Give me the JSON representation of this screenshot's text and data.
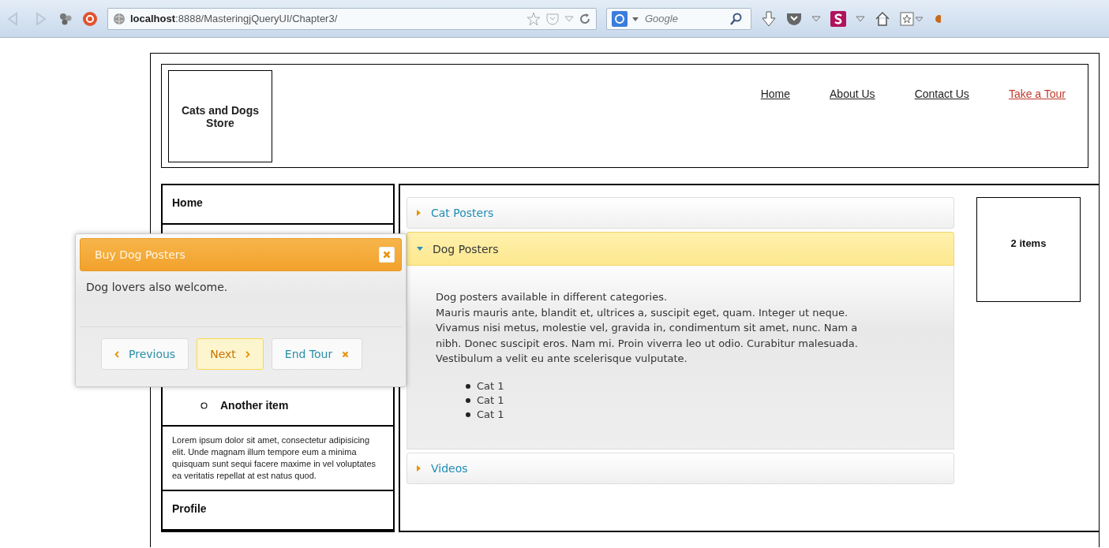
{
  "browser": {
    "url_host": "localhost",
    "url_path": ":8888/MasteringjQueryUI/Chapter3/",
    "search_placeholder": "Google"
  },
  "header": {
    "logo": "Cats and Dogs Store",
    "nav": [
      {
        "label": "Home",
        "highlighted": false
      },
      {
        "label": "About Us",
        "highlighted": false
      },
      {
        "label": "Contact Us",
        "highlighted": false
      },
      {
        "label": "Take a Tour",
        "highlighted": true
      }
    ]
  },
  "sidebar": {
    "items": [
      {
        "kind": "link",
        "label": "Home"
      },
      {
        "kind": "subitem",
        "label": "Another item"
      },
      {
        "kind": "text",
        "label": "Lorem ipsum dolor sit amet, consectetur adipisicing elit. Unde magnam illum tempore eum a minima quisquam sunt sequi facere maxime in vel voluptates ea veritatis repellat at est natus quod."
      },
      {
        "kind": "link",
        "label": "Profile"
      }
    ]
  },
  "accordion": {
    "sections": [
      {
        "title": "Cat Posters",
        "expanded": false
      },
      {
        "title": "Dog Posters",
        "expanded": true,
        "paragraphs": [
          "Dog posters available in different categories.",
          "Mauris mauris ante, blandit et, ultrices a, suscipit eget, quam. Integer ut neque. Vivamus nisi metus, molestie vel, gravida in, condimentum sit amet, nunc. Nam a nibh. Donec suscipit eros. Nam mi. Proin viverra leo ut odio. Curabitur malesuada. Vestibulum a velit eu ante scelerisque vulputate."
        ],
        "list": [
          "Cat 1",
          "Cat 1",
          "Cat 1"
        ]
      },
      {
        "title": "Videos",
        "expanded": false
      }
    ]
  },
  "cart": {
    "label": "2 items"
  },
  "tour": {
    "title": "Buy Dog Posters",
    "body": "Dog lovers also welcome.",
    "buttons": [
      {
        "label": "Previous",
        "kind": "previous",
        "focused": false
      },
      {
        "label": "Next",
        "kind": "next",
        "focused": true
      },
      {
        "label": "End Tour",
        "kind": "end",
        "focused": false
      }
    ]
  }
}
